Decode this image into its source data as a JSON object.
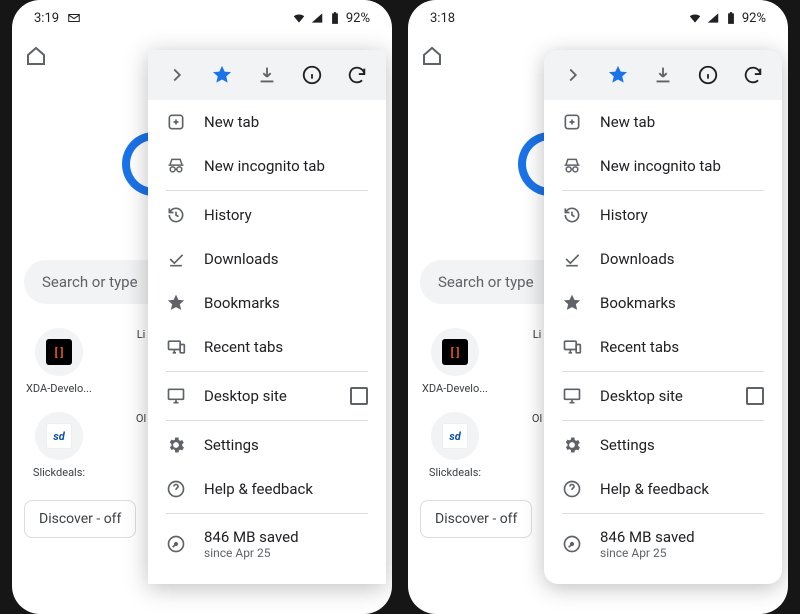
{
  "status": {
    "left": {
      "time": "3:19",
      "gmail": true
    },
    "right": {
      "time": "3:18"
    },
    "battery": "92%"
  },
  "search": {
    "placeholder": "Search or type"
  },
  "tiles": [
    {
      "label": "XDA-Develo...",
      "sub": "Li",
      "icon": "xda"
    },
    {
      "label": "Slickdeals:",
      "sub": "Ol",
      "icon": "sd"
    }
  ],
  "discover": "Discover - off",
  "menu": {
    "new_tab": "New tab",
    "incognito": "New incognito tab",
    "history": "History",
    "downloads": "Downloads",
    "bookmarks": "Bookmarks",
    "recent": "Recent tabs",
    "desktop": "Desktop site",
    "settings": "Settings",
    "help": "Help & feedback",
    "saved_main": "846 MB saved",
    "saved_sub": "since Apr 25"
  }
}
